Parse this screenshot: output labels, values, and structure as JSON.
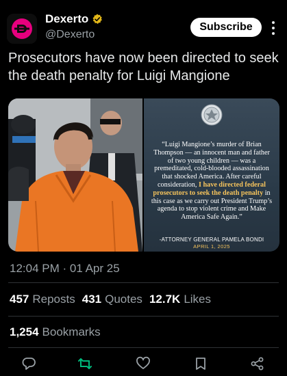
{
  "account": {
    "name": "Dexerto",
    "handle": "@Dexerto",
    "verified": true
  },
  "header": {
    "subscribe_label": "Subscribe",
    "more_icon": "more-vertical-icon"
  },
  "tweet": {
    "text": "Prosecutors have now been directed to seek the death penalty for Luigi Mangione",
    "media": {
      "quote_pre": "“Luigi Mangione’s murder of Brian Thompson — an innocent man and father of two young children — was a premeditated, cold-blooded assassination that shocked America. After careful consideration, ",
      "quote_highlight": "I have directed federal prosecutors to seek the death penalty",
      "quote_post": " in this case as we carry out President Trump’s agenda to stop violent crime and Make America Safe Again.”",
      "attribution": "-ATTORNEY GENERAL PAMELA BONDI",
      "attribution_date": "APRIL 1, 2025"
    },
    "timestamp": "12:04 PM · 01 Apr 25"
  },
  "stats": {
    "reposts_count": "457",
    "reposts_label": "Reposts",
    "quotes_count": "431",
    "quotes_label": "Quotes",
    "likes_count": "12.7K",
    "likes_label": "Likes",
    "bookmarks_count": "1,254",
    "bookmarks_label": "Bookmarks"
  },
  "actions": [
    "reply-icon",
    "repost-icon",
    "like-icon",
    "bookmark-icon",
    "share-icon"
  ],
  "colors": {
    "background": "#000000",
    "text": "#e7e9ea",
    "muted": "#9aa1a6",
    "repost_green": "#00ba7c",
    "highlight": "#f5c35c",
    "verified_gold": "#e2b719",
    "brand_pink": "#e6007e"
  }
}
